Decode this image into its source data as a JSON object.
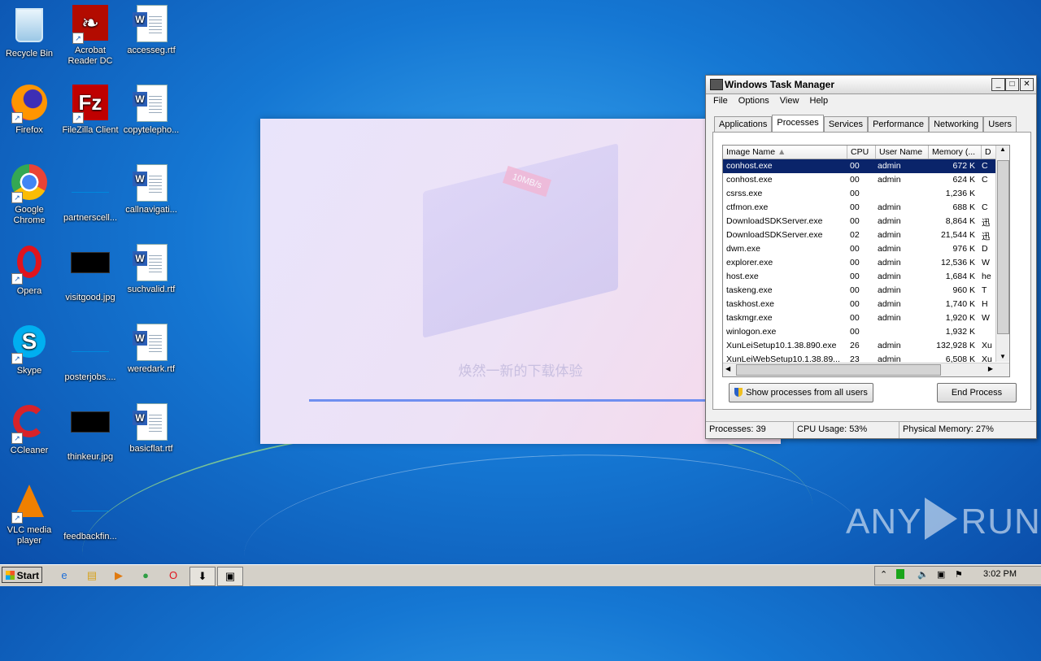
{
  "desktop": {
    "icons": [
      {
        "label": "Recycle Bin"
      },
      {
        "label": "Acrobat Reader DC"
      },
      {
        "label": "accesseg.rtf"
      },
      {
        "label": "Firefox"
      },
      {
        "label": "FileZilla Client"
      },
      {
        "label": "copytelepho..."
      },
      {
        "label": "Google Chrome"
      },
      {
        "label": "partnerscell..."
      },
      {
        "label": "callnavigati..."
      },
      {
        "label": "Opera"
      },
      {
        "label": "visitgood.jpg"
      },
      {
        "label": "suchvalid.rtf"
      },
      {
        "label": "Skype"
      },
      {
        "label": "posterjobs...."
      },
      {
        "label": "weredark.rtf"
      },
      {
        "label": "CCleaner"
      },
      {
        "label": "thinkeur.jpg"
      },
      {
        "label": "basicflat.rtf"
      },
      {
        "label": "VLC media player"
      },
      {
        "label": "feedbackfin..."
      }
    ]
  },
  "installer": {
    "badge": "10MB/s",
    "tagline": "焕然一新的下载体验",
    "progress": 0.94
  },
  "taskmanager": {
    "title": "Windows Task Manager",
    "menu": [
      "File",
      "Options",
      "View",
      "Help"
    ],
    "tabs": [
      "Applications",
      "Processes",
      "Services",
      "Performance",
      "Networking",
      "Users"
    ],
    "active_tab": "Processes",
    "columns": [
      "Image Name",
      "CPU",
      "User Name",
      "Memory (...",
      "D"
    ],
    "rows": [
      {
        "name": "conhost.exe",
        "cpu": "00",
        "user": "admin",
        "mem": "672 K",
        "d": "C"
      },
      {
        "name": "conhost.exe",
        "cpu": "00",
        "user": "admin",
        "mem": "624 K",
        "d": "C"
      },
      {
        "name": "csrss.exe",
        "cpu": "00",
        "user": "",
        "mem": "1,236 K",
        "d": ""
      },
      {
        "name": "ctfmon.exe",
        "cpu": "00",
        "user": "admin",
        "mem": "688 K",
        "d": "C"
      },
      {
        "name": "DownloadSDKServer.exe",
        "cpu": "00",
        "user": "admin",
        "mem": "8,864 K",
        "d": "迅"
      },
      {
        "name": "DownloadSDKServer.exe",
        "cpu": "02",
        "user": "admin",
        "mem": "21,544 K",
        "d": "迅"
      },
      {
        "name": "dwm.exe",
        "cpu": "00",
        "user": "admin",
        "mem": "976 K",
        "d": "D"
      },
      {
        "name": "explorer.exe",
        "cpu": "00",
        "user": "admin",
        "mem": "12,536 K",
        "d": "W"
      },
      {
        "name": "host.exe",
        "cpu": "00",
        "user": "admin",
        "mem": "1,684 K",
        "d": "he"
      },
      {
        "name": "taskeng.exe",
        "cpu": "00",
        "user": "admin",
        "mem": "960 K",
        "d": "T"
      },
      {
        "name": "taskhost.exe",
        "cpu": "00",
        "user": "admin",
        "mem": "1,740 K",
        "d": "H"
      },
      {
        "name": "taskmgr.exe",
        "cpu": "00",
        "user": "admin",
        "mem": "1,920 K",
        "d": "W"
      },
      {
        "name": "winlogon.exe",
        "cpu": "00",
        "user": "",
        "mem": "1,932 K",
        "d": ""
      },
      {
        "name": "XunLeiSetup10.1.38.890.exe",
        "cpu": "26",
        "user": "admin",
        "mem": "132,928 K",
        "d": "Xu"
      },
      {
        "name": "XunLeiWebSetup10.1.38.89...",
        "cpu": "23",
        "user": "admin",
        "mem": "6,508 K",
        "d": "Xu"
      }
    ],
    "show_all_label": "Show processes from all users",
    "end_process_label": "End Process",
    "status": {
      "processes": "Processes: 39",
      "cpu": "CPU Usage: 53%",
      "memory": "Physical Memory: 27%"
    }
  },
  "taskbar": {
    "start_label": "Start",
    "clock": "3:02 PM"
  },
  "watermark": {
    "left": "ANY",
    "right": "RUN"
  }
}
